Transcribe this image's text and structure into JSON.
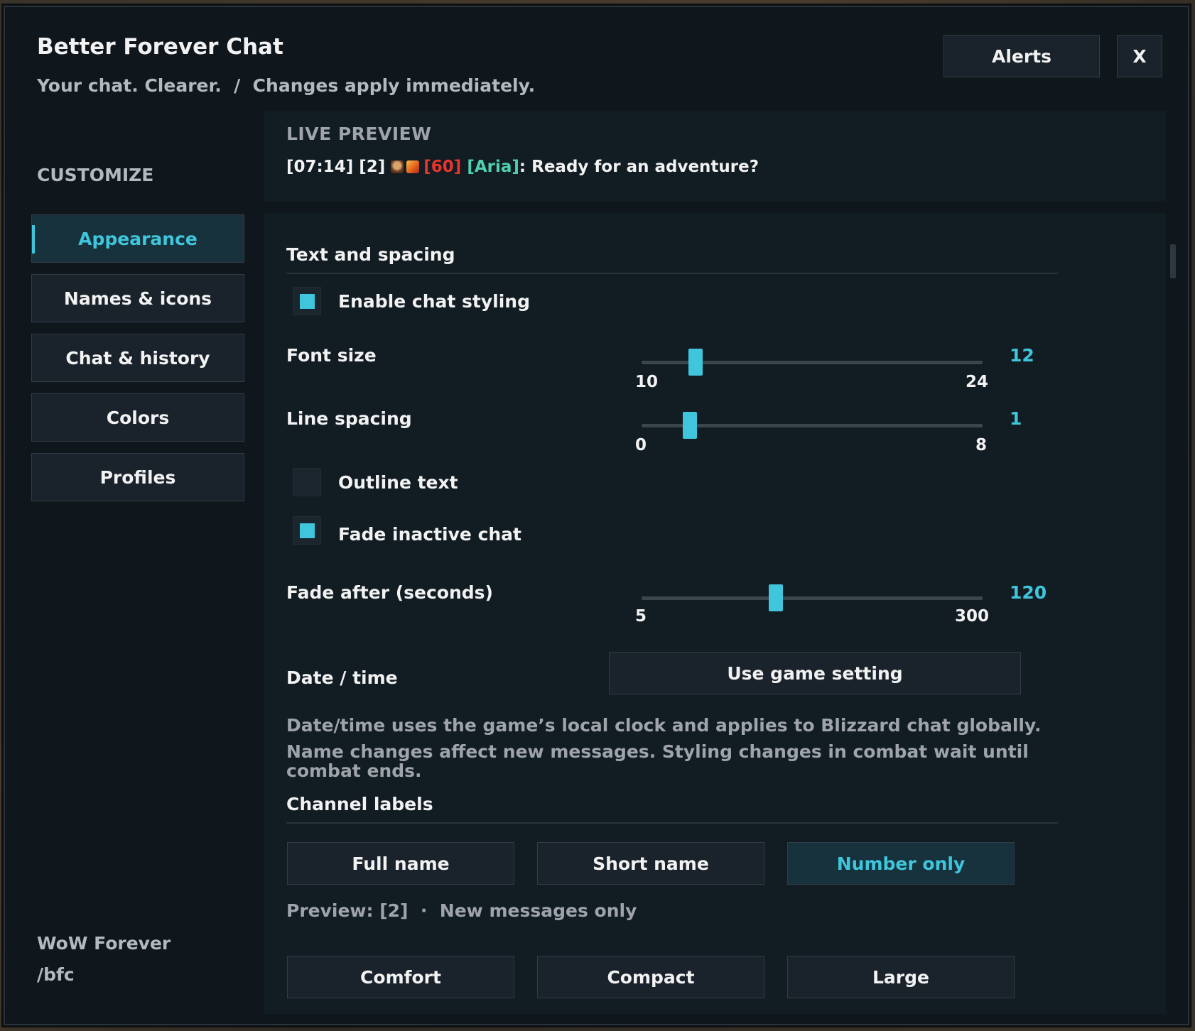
{
  "app": {
    "title": "Better Forever Chat",
    "subtitle": "Your chat. Clearer.  /  Changes apply immediately."
  },
  "header": {
    "alerts_label": "Alerts",
    "close_label": "X"
  },
  "sidebar": {
    "heading": "CUSTOMIZE",
    "items": [
      {
        "label": "Appearance",
        "active": true
      },
      {
        "label": "Names & icons",
        "active": false
      },
      {
        "label": "Chat & history",
        "active": false
      },
      {
        "label": "Colors",
        "active": false
      },
      {
        "label": "Profiles",
        "active": false
      }
    ],
    "footer_name": "WoW Forever",
    "footer_command": "/bfc"
  },
  "preview": {
    "heading": "LIVE PREVIEW",
    "timestamp": "[07:14] [2] ",
    "level": "[60]",
    "name": "[Aria]",
    "message": ": Ready for an adventure?"
  },
  "settings": {
    "section_title": "Text and spacing",
    "enable_styling": {
      "label": "Enable chat styling",
      "checked": true
    },
    "font_size": {
      "label": "Font size",
      "min": "10",
      "max": "24",
      "value": "12",
      "fraction": 0.143
    },
    "line_spacing": {
      "label": "Line spacing",
      "min": "0",
      "max": "8",
      "value": "1",
      "fraction": 0.125
    },
    "outline_text": {
      "label": "Outline text",
      "checked": false
    },
    "fade_inactive": {
      "label": "Fade inactive chat",
      "checked": true
    },
    "fade_after": {
      "label": "Fade after (seconds)",
      "min": "5",
      "max": "300",
      "value": "120",
      "fraction": 0.39
    },
    "date_time": {
      "label": "Date / time",
      "button_label": "Use game setting"
    },
    "note_1": "Date/time uses the game’s local clock and applies to Blizzard chat globally.",
    "note_2": "Name changes affect new messages. Styling changes in combat wait until combat ends.",
    "channel_labels": {
      "title": "Channel labels",
      "options": [
        {
          "label": "Full name",
          "active": false
        },
        {
          "label": "Short name",
          "active": false
        },
        {
          "label": "Number only",
          "active": true
        }
      ],
      "preview_text": "Preview: [2]  ·  New messages only"
    },
    "presets": [
      {
        "label": "Comfort"
      },
      {
        "label": "Compact"
      },
      {
        "label": "Large"
      }
    ]
  },
  "colors": {
    "accent": "#3fc6dc",
    "level_red": "#e8352c",
    "name_green": "#4fd0b0"
  }
}
